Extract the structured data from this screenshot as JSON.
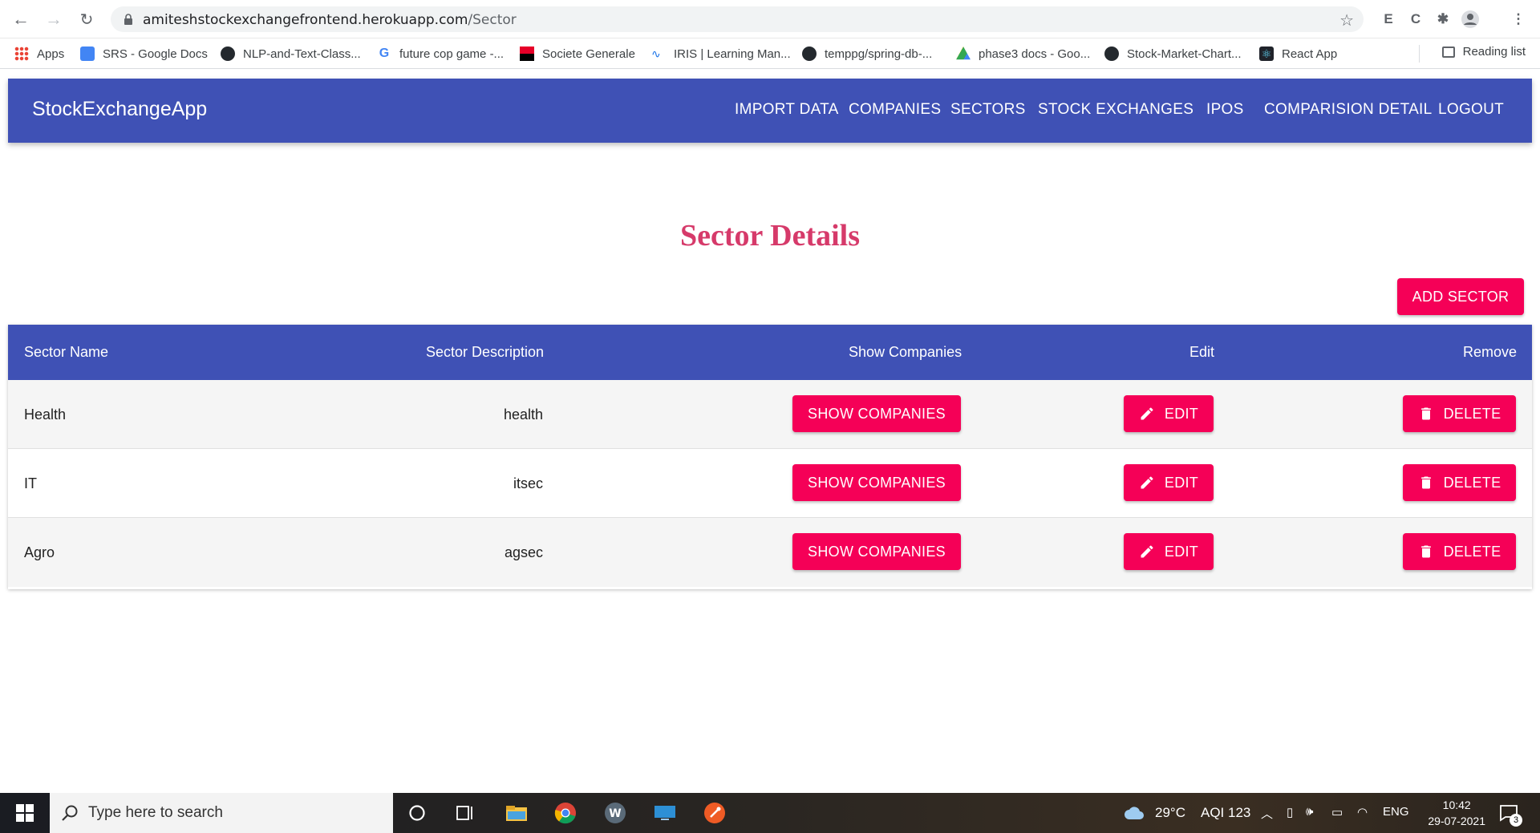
{
  "browser": {
    "url_host": "amiteshstockexchangefrontend.herokuapp.com",
    "url_path": "/Sector",
    "bookmarks": [
      {
        "label": "Apps",
        "icon": "apps-grid-icon",
        "color": "#4285f4"
      },
      {
        "label": "SRS - Google Docs",
        "icon": "google-docs-icon",
        "color": "#4285f4"
      },
      {
        "label": "NLP-and-Text-Class...",
        "icon": "github-icon",
        "color": "#24292e"
      },
      {
        "label": "future cop game -...",
        "icon": "google-icon",
        "color": "#4285f4"
      },
      {
        "label": "Societe Generale",
        "icon": "societe-generale-icon",
        "color": "#e60028"
      },
      {
        "label": "IRIS | Learning Man...",
        "icon": "iris-icon",
        "color": "#1a73e8"
      },
      {
        "label": "temppg/spring-db-...",
        "icon": "github-icon",
        "color": "#24292e"
      },
      {
        "label": "phase3 docs - Goo...",
        "icon": "google-drive-icon",
        "color": "#34a853"
      },
      {
        "label": "Stock-Market-Chart...",
        "icon": "github-icon",
        "color": "#24292e"
      },
      {
        "label": "React App",
        "icon": "react-icon",
        "color": "#61dafb"
      }
    ],
    "reading_list": "Reading list"
  },
  "app": {
    "brand": "StockExchangeApp",
    "menu": [
      "IMPORT DATA",
      "COMPANIES",
      "SECTORS",
      "STOCK EXCHANGES",
      "IPOS",
      "COMPARISION DETAIL",
      "LOGOUT"
    ],
    "accent": "#3f51b5",
    "button_color": "#f50057"
  },
  "page": {
    "title": "Sector Details",
    "add_button": "ADD SECTOR",
    "columns": [
      "Sector Name",
      "Sector Description",
      "Show Companies",
      "Edit",
      "Remove"
    ],
    "rows": [
      {
        "name": "Health",
        "description": "health"
      },
      {
        "name": "IT",
        "description": "itsec"
      },
      {
        "name": "Agro",
        "description": "agsec"
      }
    ],
    "show_label": "SHOW COMPANIES",
    "edit_label": "EDIT",
    "delete_label": "DELETE"
  },
  "taskbar": {
    "search_placeholder": "Type here to search",
    "weather": "29°C",
    "aqi": "AQI 123",
    "lang": "ENG",
    "time": "10:42",
    "date": "29-07-2021",
    "notifications": "3"
  }
}
